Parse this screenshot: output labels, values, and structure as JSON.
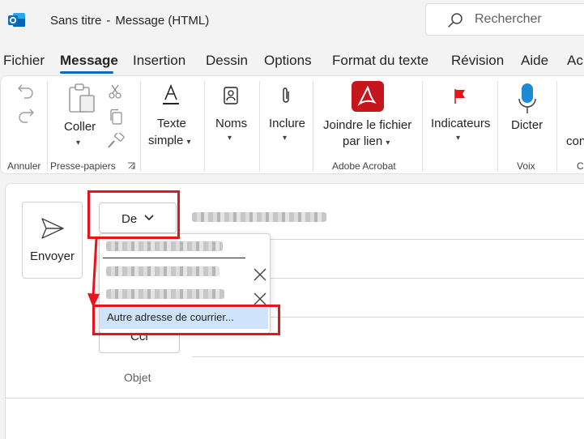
{
  "window": {
    "doc_title": "Sans titre",
    "separator": "-",
    "doc_type": "Message (HTML)"
  },
  "search": {
    "placeholder": "Rechercher"
  },
  "menu": {
    "tabs": [
      "Fichier",
      "Message",
      "Insertion",
      "Dessin",
      "Options",
      "Format du texte",
      "Révision",
      "Aide",
      "Acr"
    ],
    "active_index": 1
  },
  "ribbon": {
    "undo_group_label": "Annuler",
    "clipboard": {
      "paste_label": "Coller",
      "group_label": "Presse-papiers"
    },
    "text_style": {
      "line1": "Texte",
      "line2": "simple"
    },
    "names_label": "Noms",
    "include_label": "Inclure",
    "acrobat": {
      "line1": "Joindre le fichier",
      "line2": "par lien",
      "group_label": "Adobe Acrobat"
    },
    "flags_label": "Indicateurs",
    "dictate": {
      "label": "Dicter",
      "group_label": "Voix"
    },
    "partial_label": "con",
    "partial_group": "C"
  },
  "compose": {
    "send_label": "Envoyer",
    "from_label": "De",
    "cci_label": "Cci",
    "subject_label": "Objet"
  },
  "from_dropdown": {
    "other_address_label": "Autre adresse de courrier..."
  },
  "colors": {
    "accent": "#0f6cbd",
    "annotation_red": "#e8141b",
    "highlight_blue": "#cfe4fa",
    "acrobat_red": "#c4161c"
  }
}
